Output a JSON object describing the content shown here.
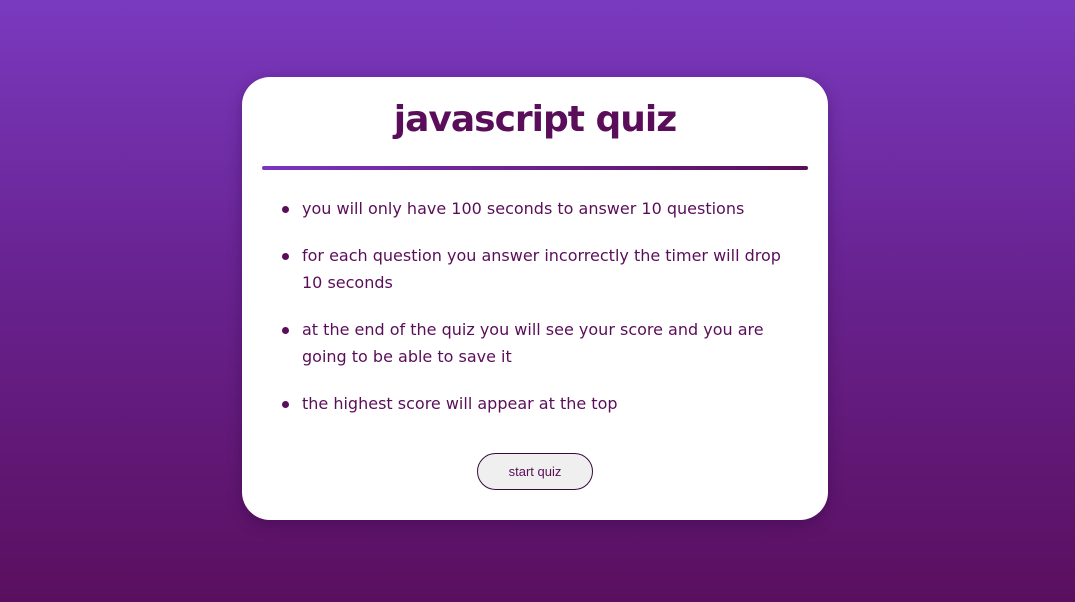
{
  "quiz": {
    "title": "javascript quiz",
    "rules": [
      "you will only have 100 seconds to answer 10 questions",
      "for each question you answer incorrectly the timer will drop 10 seconds",
      "at the end of the quiz you will see your score and you are going to be able to save it",
      "the highest score will appear at the top"
    ],
    "start_button_label": "start quiz"
  },
  "colors": {
    "background_top": "#7a3abf",
    "background_bottom": "#5a0f5e",
    "card": "#ffffff",
    "text": "#5a0e59",
    "divider_start": "#7b34c0",
    "divider_end": "#5a0e59"
  }
}
